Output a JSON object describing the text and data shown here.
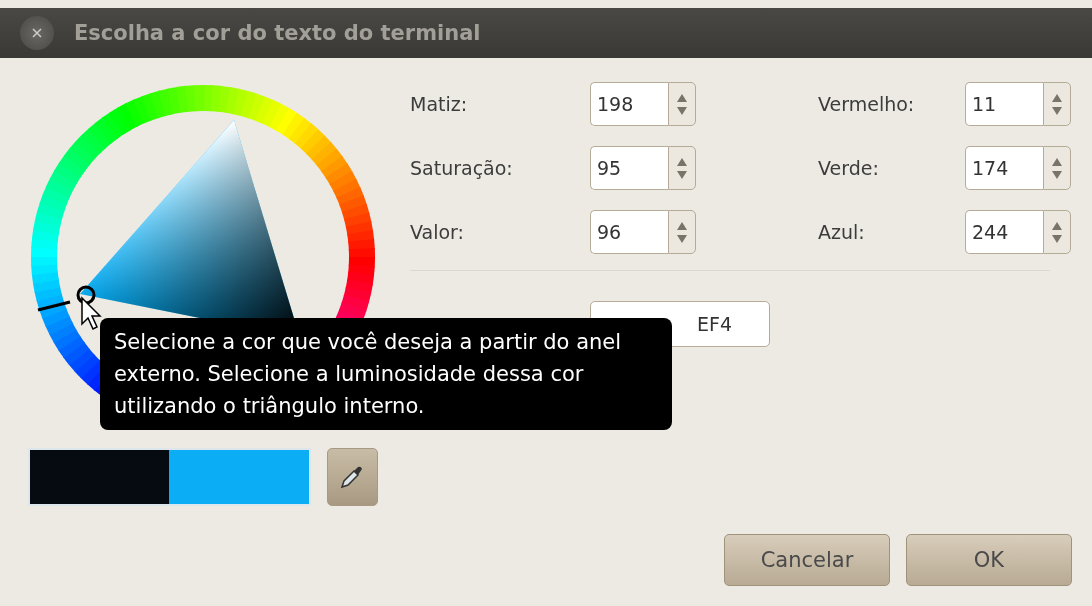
{
  "window": {
    "title": "Escolha a cor do texto do terminal"
  },
  "hsv": [
    {
      "label": "Matiz:",
      "value": "198"
    },
    {
      "label": "Saturação:",
      "value": "95"
    },
    {
      "label": "Valor:",
      "value": "96"
    }
  ],
  "rgb": [
    {
      "label": "Vermelho:",
      "value": "11"
    },
    {
      "label": "Verde:",
      "value": "174"
    },
    {
      "label": "Azul:",
      "value": "244"
    }
  ],
  "color_name": {
    "value": "EF4"
  },
  "swatches": [
    {
      "color": "#050b10"
    },
    {
      "color": "#0baef4"
    }
  ],
  "tooltip": "Selecione a cor que você deseja a partir do anel externo. Selecione a luminosidade dessa cor utilizando o triângulo interno.",
  "buttons": [
    "Cancelar",
    "OK"
  ]
}
